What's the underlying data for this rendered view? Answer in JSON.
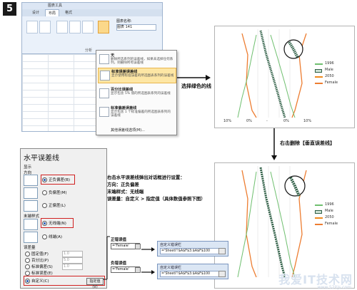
{
  "step_number": "5",
  "excel": {
    "ribbon_title": "图表工具",
    "tabs": [
      "设计",
      "布局",
      "格式"
    ],
    "chart_name_label": "图表名称:",
    "chart_name_value": "图表 141",
    "group_label": "分析"
  },
  "error_bar_menu": {
    "items": [
      {
        "title": "无",
        "desc": "删除所选系列的误差线，如果未选择任何系列，则删除所有误差线",
        "selected": false
      },
      {
        "title": "标准误差误差线",
        "desc": "显示使用标准误差的所选图表系列的误差线",
        "selected": true
      },
      {
        "title": "百分比误差线",
        "desc": "显示包含 5% 值的所选图表系列的误差线",
        "selected": false
      },
      {
        "title": "标准偏差误差线",
        "desc": "显示包含 1 个标准偏差的所选图表系列的误差线",
        "selected": false
      }
    ],
    "more_options": "其他误差线选项(M)..."
  },
  "arrow1_label": "选择绿色的线",
  "arrow2_label": "右击删除【垂直误差线】",
  "charts": {
    "legend": [
      "1996",
      "Male",
      "2050",
      "Female"
    ],
    "x_ticks": [
      "10%",
      "0%",
      "-",
      "0%",
      "10%"
    ],
    "colors": {
      "1996": "#6fbf6f",
      "male": "#2e5e45",
      "2050": "#f08a1c",
      "female": "#ed7d31"
    }
  },
  "dialog": {
    "title": "水平误差线",
    "display_label": "显示",
    "direction_label": "方向",
    "direction_options": [
      "正负偏差(B)",
      "负偏差(M)",
      "正偏差(L)"
    ],
    "end_style_label": "末端样式",
    "end_style_options": [
      "无线端(N)",
      "线端(A)"
    ],
    "error_amount_label": "误差量",
    "error_amount_options": [
      "固定值(F)",
      "百分比(P)",
      "标准偏差(S)",
      "标准误差(E)",
      "自定义(C)"
    ],
    "fixed_value": "1.0",
    "percent_value": "5.0",
    "std_value": "1.0",
    "specify_button": "指定值(V)"
  },
  "instructions": {
    "line1": "右击水平误差线弹出对话框进行设置：",
    "line2": "方向：正负偏差",
    "line3": "末端样式：无线端",
    "line4": "误差量：自定义 > 指定值（具体数值参照下图）"
  },
  "custom_error": {
    "positive_label": "正错误值",
    "negative_label": "负错误值",
    "positive_value": "='Female'",
    "negative_value": "='Female'",
    "box_title": "自定义错误栏",
    "top_value": "='SheetI'!$A$F$3:$A$F$100",
    "bottom_value": "='SheetI'!$A$F$3:$A$F$100"
  },
  "watermark": "我爱IT技术网",
  "watermark_url": "www.52itjs.com"
}
